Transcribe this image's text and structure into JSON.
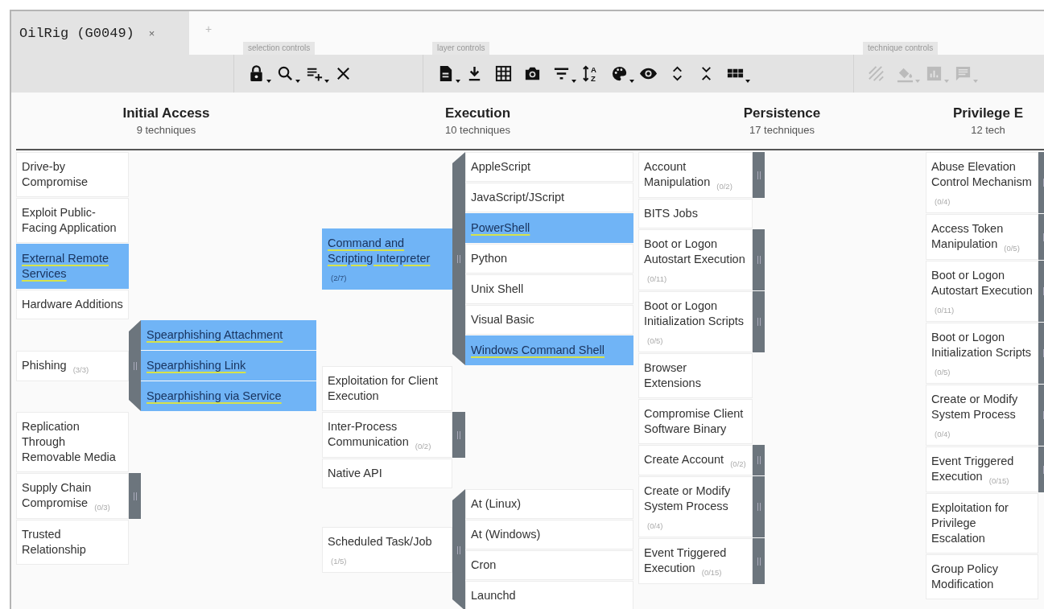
{
  "tabs": [
    {
      "label": "OilRig (G0049)",
      "selected": true,
      "close": "×"
    }
  ],
  "new_tab": "+",
  "toolbar": [
    {
      "label": "selection controls",
      "buttons": [
        {
          "kind": "lock",
          "dropdown": true,
          "disabled": false
        },
        {
          "kind": "search",
          "dropdown": true,
          "disabled": false
        },
        {
          "kind": "multiselect",
          "dropdown": true,
          "disabled": false
        },
        {
          "kind": "clear",
          "dropdown": false,
          "disabled": false
        }
      ]
    },
    {
      "label": "layer controls",
      "buttons": [
        {
          "kind": "file",
          "dropdown": true,
          "disabled": false
        },
        {
          "kind": "download",
          "dropdown": false,
          "disabled": false
        },
        {
          "kind": "table",
          "dropdown": false,
          "disabled": false
        },
        {
          "kind": "camera",
          "dropdown": false,
          "disabled": false
        },
        {
          "kind": "filter",
          "dropdown": true,
          "disabled": false
        },
        {
          "kind": "sort",
          "letters": [
            "A",
            "Z"
          ],
          "dropdown": false,
          "disabled": false
        },
        {
          "kind": "palette",
          "dropdown": true,
          "disabled": false
        },
        {
          "kind": "eye",
          "dropdown": false,
          "disabled": false
        },
        {
          "kind": "expand",
          "dropdown": false,
          "disabled": false
        },
        {
          "kind": "collapse",
          "dropdown": false,
          "disabled": false
        },
        {
          "kind": "grid",
          "dropdown": true,
          "disabled": false
        }
      ]
    },
    {
      "label": "technique controls",
      "buttons": [
        {
          "kind": "hatch",
          "dropdown": false,
          "disabled": true
        },
        {
          "kind": "bucket",
          "dropdown": true,
          "disabled": true
        },
        {
          "kind": "chart",
          "dropdown": true,
          "disabled": true
        },
        {
          "kind": "comment",
          "dropdown": true,
          "disabled": true
        }
      ]
    }
  ],
  "tactics": [
    {
      "name": "Initial Access",
      "count": "9 techniques",
      "techniques": [
        {
          "name": "Drive-by Compromise",
          "kind": "plain",
          "selected": false
        },
        {
          "name": "Exploit Public-Facing Application",
          "kind": "plain",
          "selected": false
        },
        {
          "name": "External Remote Services",
          "kind": "plain",
          "selected": true
        },
        {
          "name": "Hardware Additions",
          "kind": "plain",
          "selected": false
        },
        {
          "name": "Phishing",
          "count": "(3/3)",
          "kind": "expanded",
          "selected": false,
          "subtechniques": [
            {
              "name": "Spearphishing Attachment",
              "selected": true
            },
            {
              "name": "Spearphishing Link",
              "selected": true
            },
            {
              "name": "Spearphishing via Service",
              "selected": true
            }
          ]
        },
        {
          "name": "Replication Through Removable Media",
          "kind": "plain",
          "selected": false
        },
        {
          "name": "Supply Chain Compromise",
          "count": "(0/3)",
          "kind": "collapsed",
          "selected": false
        },
        {
          "name": "Trusted Relationship",
          "kind": "plain",
          "selected": false
        }
      ]
    },
    {
      "name": "Execution",
      "count": "10 techniques",
      "techniques": [
        {
          "name": "Command and Scripting Interpreter",
          "count": "(2/7)",
          "kind": "expanded",
          "selected": true,
          "subtechniques": [
            {
              "name": "AppleScript",
              "selected": false
            },
            {
              "name": "JavaScript/JScript",
              "selected": false
            },
            {
              "name": "PowerShell",
              "selected": true
            },
            {
              "name": "Python",
              "selected": false
            },
            {
              "name": "Unix Shell",
              "selected": false
            },
            {
              "name": "Visual Basic",
              "selected": false
            },
            {
              "name": "Windows Command Shell",
              "selected": true
            }
          ]
        },
        {
          "name": "Exploitation for Client Execution",
          "kind": "plain",
          "selected": false
        },
        {
          "name": "Inter-Process Communication",
          "count": "(0/2)",
          "kind": "collapsed",
          "selected": false
        },
        {
          "name": "Native API",
          "kind": "plain",
          "selected": false
        },
        {
          "name": "Scheduled Task/Job",
          "count": "(1/5)",
          "kind": "expanded",
          "selected": false,
          "subtechniques": [
            {
              "name": "At (Linux)",
              "selected": false
            },
            {
              "name": "At (Windows)",
              "selected": false
            },
            {
              "name": "Cron",
              "selected": false
            },
            {
              "name": "Launchd",
              "selected": false
            }
          ]
        }
      ]
    },
    {
      "name": "Persistence",
      "count": "17 techniques",
      "techniques": [
        {
          "name": "Account Manipulation",
          "count": "(0/2)",
          "kind": "collapsed",
          "selected": false
        },
        {
          "name": "BITS Jobs",
          "kind": "plain",
          "selected": false
        },
        {
          "name": "Boot or Logon Autostart Execution",
          "count": "(0/11)",
          "kind": "collapsed",
          "selected": false
        },
        {
          "name": "Boot or Logon Initialization Scripts",
          "count": "(0/5)",
          "kind": "collapsed",
          "selected": false
        },
        {
          "name": "Browser Extensions",
          "kind": "plain",
          "selected": false
        },
        {
          "name": "Compromise Client Software Binary",
          "kind": "plain",
          "selected": false
        },
        {
          "name": "Create Account",
          "count": "(0/2)",
          "kind": "collapsed",
          "selected": false
        },
        {
          "name": "Create or Modify System Process",
          "count": "(0/4)",
          "kind": "collapsed",
          "selected": false
        },
        {
          "name": "Event Triggered Execution",
          "count": "(0/15)",
          "kind": "collapsed",
          "selected": false
        }
      ]
    },
    {
      "name": "Privilege E",
      "count": "12 tech",
      "techniques": [
        {
          "name": "Abuse Elevation Control Mechanism",
          "count": "(0/4)",
          "kind": "collapsed",
          "selected": false
        },
        {
          "name": "Access Token Manipulation",
          "count": "(0/5)",
          "kind": "collapsed",
          "selected": false
        },
        {
          "name": "Boot or Logon Autostart Execution",
          "count": "(0/11)",
          "kind": "collapsed",
          "selected": false
        },
        {
          "name": "Boot or Logon Initialization Scripts",
          "count": "(0/5)",
          "kind": "collapsed",
          "selected": false
        },
        {
          "name": "Create or Modify System Process",
          "count": "(0/4)",
          "kind": "collapsed",
          "selected": false
        },
        {
          "name": "Event Triggered Execution",
          "count": "(0/15)",
          "kind": "collapsed",
          "selected": false
        },
        {
          "name": "Exploitation for Privilege Escalation",
          "kind": "plain",
          "selected": false
        },
        {
          "name": "Group Policy Modification",
          "kind": "plain",
          "selected": false
        }
      ]
    }
  ]
}
